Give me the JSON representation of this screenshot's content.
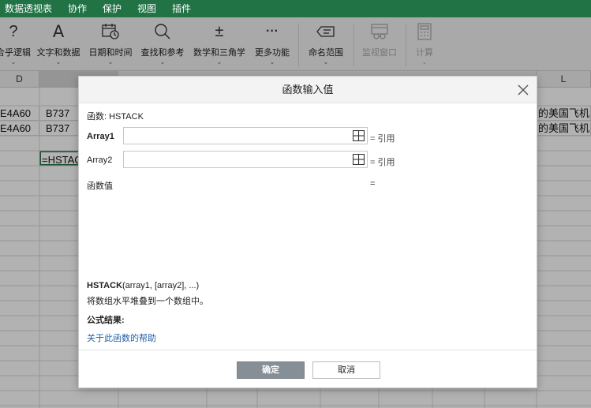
{
  "menu": [
    "数据透视表",
    "协作",
    "保护",
    "视图",
    "插件"
  ],
  "ribbon": {
    "logic": {
      "icon": "?",
      "label": "合乎逻辑",
      "icon_name": "question-icon"
    },
    "text": {
      "icon": "A",
      "label": "文字和数据",
      "icon_name": "text-icon"
    },
    "datetime": {
      "label": "日期和时间",
      "icon_name": "calendar-clock-icon"
    },
    "lookup": {
      "label": "查找和参考",
      "icon_name": "search-icon"
    },
    "math": {
      "icon": "±",
      "label": "数学和三角学",
      "icon_name": "plus-minus-icon"
    },
    "more": {
      "icon": "···",
      "label": "更多功能",
      "icon_name": "more-icon"
    },
    "named": {
      "label": "命名范围",
      "icon_name": "tag-icon"
    },
    "watch": {
      "label": "监视窗口",
      "icon_name": "watch-window-icon"
    },
    "calc": {
      "label": "计算",
      "icon_name": "calculator-icon"
    }
  },
  "grid": {
    "col_d": "D",
    "col_l": "L",
    "row1": {
      "d": "E4A60",
      "e": "B737",
      "l": "的美国飞机"
    },
    "row2": {
      "d": "E4A60",
      "e": "B737",
      "l": "的美国飞机"
    },
    "formula_cell": "=HSTACK"
  },
  "dialog": {
    "title": "函数输入值",
    "function_line": "函数: HSTACK",
    "args": [
      {
        "label": "Array1",
        "value": "",
        "result": "= 引用",
        "bold": true
      },
      {
        "label": "Array2",
        "value": "",
        "result": "= 引用",
        "bold": false
      }
    ],
    "value_label": "函数值",
    "value_eq": "=",
    "syntax_name": "HSTACK",
    "syntax_args": "(array1, [array2], ...)",
    "description": "将数组水平堆叠到一个数组中。",
    "result_label": "公式结果:",
    "help_link": "关于此函数的帮助",
    "ok_label": "确定",
    "cancel_label": "取消"
  },
  "colors": {
    "menubar": "#217346",
    "ok_button": "#868e96",
    "link": "#1f5fa8"
  }
}
